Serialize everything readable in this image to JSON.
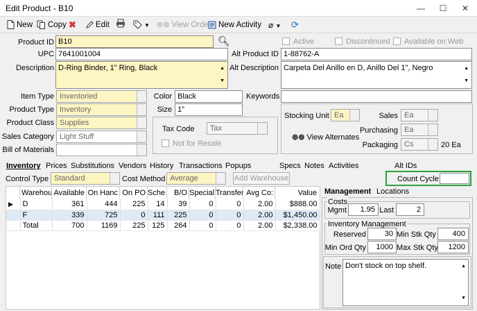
{
  "window": {
    "title": "Edit Product - B10",
    "minimize": "—",
    "maximize": "☐",
    "close": "✕"
  },
  "toolbar": {
    "new": "New",
    "copy": "Copy",
    "edit": "Edit",
    "view_order": "View Order",
    "new_activity": "New Activity"
  },
  "product": {
    "product_id_label": "Product ID",
    "product_id": "B10",
    "upc_label": "UPC",
    "upc": "7641001004",
    "description_label": "Description",
    "description": "D-Ring Binder, 1\" Ring, Black",
    "alt_product_id_label": "Alt Product ID",
    "alt_product_id": "1-88762-A",
    "alt_description_label": "Alt Description",
    "alt_description": "Carpeta Del Anillo en D, Anillo Del 1\", Negro",
    "active_label": "Active",
    "discontinued_label": "Discontinued",
    "available_web_label": "Available on Web",
    "item_type_label": "Item Type",
    "item_type": "Inventoried",
    "product_type_label": "Product Type",
    "product_type": "Inventory",
    "product_class_label": "Product Class",
    "product_class": "Supplies",
    "sales_category_label": "Sales Category",
    "sales_category": "Light Stuff",
    "bom_label": "Bill of Materials",
    "bom": "",
    "color_label": "Color",
    "color": "Black",
    "size_label": "Size",
    "size": "1\"",
    "keywords_label": "Keywords",
    "keywords": "",
    "tax_code_label": "Tax Code",
    "tax_code": "Tax",
    "not_for_resale_label": "Not for Resale",
    "stocking_unit_label": "Stocking Unit",
    "stocking_unit": "Ea",
    "sales_label": "Sales",
    "sales_unit": "Ea",
    "purchasing_label": "Purchasing",
    "purchasing_unit": "Ea",
    "packaging_label": "Packaging",
    "packaging_unit": "Cs",
    "packaging_qty": "20 Ea",
    "view_alternates": "View Alternates"
  },
  "tabs": [
    "Inventory",
    "Prices",
    "Substitutions",
    "Vendors",
    "History",
    "Transactions",
    "Popups",
    "Specs",
    "Notes",
    "Activities",
    "Alt IDs"
  ],
  "inventory": {
    "control_type_label": "Control Type",
    "control_type": "Standard",
    "cost_method_label": "Cost Method",
    "cost_method": "Average",
    "add_warehouse": "Add Warehouse",
    "count_cycle_label": "Count Cycle",
    "count_cycle": "",
    "columns": [
      "Warehou",
      "Available",
      "On Hanc",
      "On PO",
      "Sche",
      "B/O",
      "Special",
      "Transfer",
      "Avg Co:",
      "Value"
    ],
    "rows": [
      {
        "marker": "▶",
        "cells": [
          "D",
          "361",
          "444",
          "225",
          "14",
          "39",
          "0",
          "0",
          "2.00",
          "$888.00"
        ]
      },
      {
        "marker": "",
        "cells": [
          "F",
          "339",
          "725",
          "0",
          "111",
          "225",
          "0",
          "0",
          "2.00",
          "$1,450.00"
        ]
      },
      {
        "marker": "",
        "cells": [
          "Total",
          "700",
          "1169",
          "225",
          "125",
          "264",
          "0",
          "0",
          "2.00",
          "$2,338.00"
        ]
      }
    ]
  },
  "management": {
    "tab_management": "Management",
    "tab_locations": "Locations",
    "costs_label": "Costs",
    "mgmt_label": "Mgmt",
    "mgmt": "1.95",
    "last_label": "Last",
    "last": "2",
    "inv_mgmt_label": "Inventory Management",
    "reserved_label": "Reserved",
    "reserved": "30",
    "min_stk_label": "Min Stk Qty",
    "min_stk": "400",
    "min_ord_label": "Min Ord Qty",
    "min_ord": "1000",
    "max_stk_label": "Max Stk Qty",
    "max_stk": "1200",
    "note_label": "Note",
    "note": "Don't stock on top shelf."
  },
  "colors": {
    "accent_highlight": "#2e9e3e",
    "yellow_field": "#fdf5c2",
    "selected_row": "#dfeaf6"
  }
}
